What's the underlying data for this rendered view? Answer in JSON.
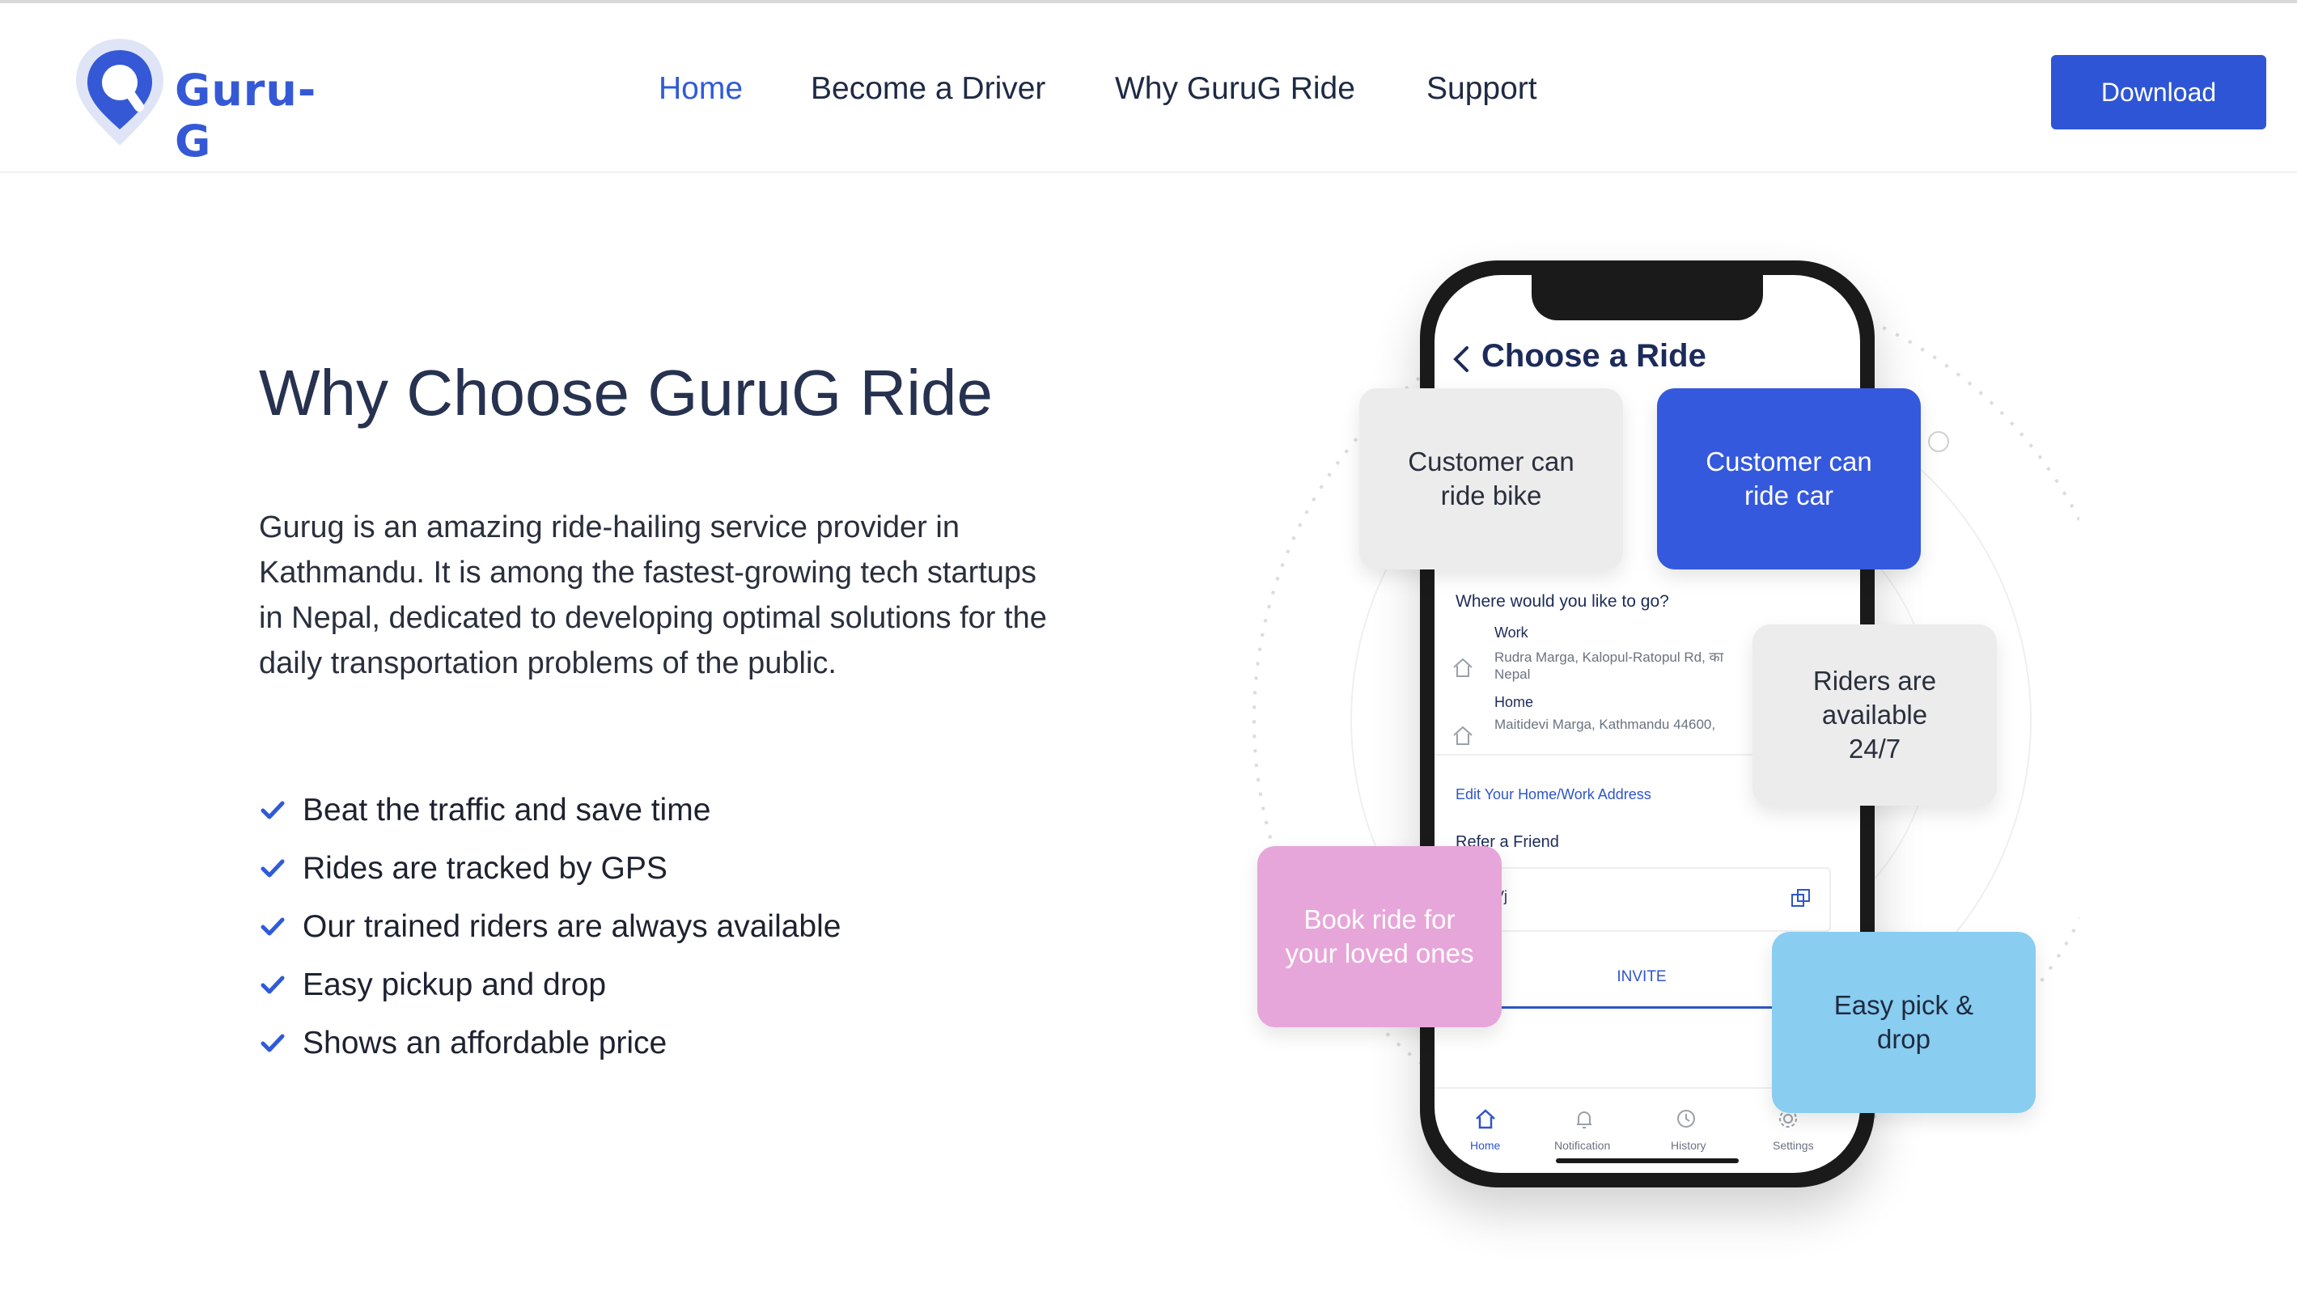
{
  "brand": {
    "name": "Guru-G",
    "logo_icon": "location-pin-icon",
    "color": "#3559d6"
  },
  "nav": [
    {
      "label": "Home",
      "active": true
    },
    {
      "label": "Become a Driver",
      "active": false
    },
    {
      "label": "Why GuruG Ride",
      "active": false
    },
    {
      "label": "Support",
      "active": false
    }
  ],
  "header": {
    "download_label": "Download",
    "accent": "#2e55d6"
  },
  "hero": {
    "title": "Why Choose GuruG Ride",
    "description": "Gurug is an amazing ride-hailing service provider in Kathmandu. It is among the fastest-growing tech startups in Nepal, dedicated to developing optimal solutions for the daily transportation problems of the public.",
    "features": [
      "Beat the traffic and save time",
      "Rides are tracked by GPS",
      "Our trained riders are always available",
      "Easy pickup and drop",
      "Shows an affordable price"
    ]
  },
  "phone": {
    "screen_title": "Choose a Ride",
    "question": "Where would you like to go?",
    "work_label": "Work",
    "work_address": "Rudra Marga, Kalopul-Ratopul Rd, का",
    "work_address_2": "Nepal",
    "home_label": "Home",
    "home_address": "Maitidevi Marga, Kathmandu 44600,",
    "edit_link": "Edit Your Home/Work Address",
    "refer_label": "Refer a Friend",
    "refer_code": "3Vj",
    "invite_label": "INVITE",
    "tabs": [
      {
        "label": "Home",
        "icon": "home-icon"
      },
      {
        "label": "Notification",
        "icon": "bell-icon"
      },
      {
        "label": "History",
        "icon": "history-icon"
      },
      {
        "label": "Settings",
        "icon": "gear-icon"
      }
    ]
  },
  "cards": {
    "bike": [
      "Customer can",
      "ride bike"
    ],
    "car": [
      "Customer can",
      "ride car"
    ],
    "riders": [
      "Riders are",
      "available",
      "24/7"
    ],
    "loved": [
      "Book ride for",
      "your loved ones"
    ],
    "pick": [
      "Easy pick &",
      "drop"
    ]
  },
  "colors": {
    "blue_card": "#3459dd",
    "pink_card": "#e7a6d9",
    "sky_card": "#89cdf0",
    "grey_card": "#ececec"
  }
}
